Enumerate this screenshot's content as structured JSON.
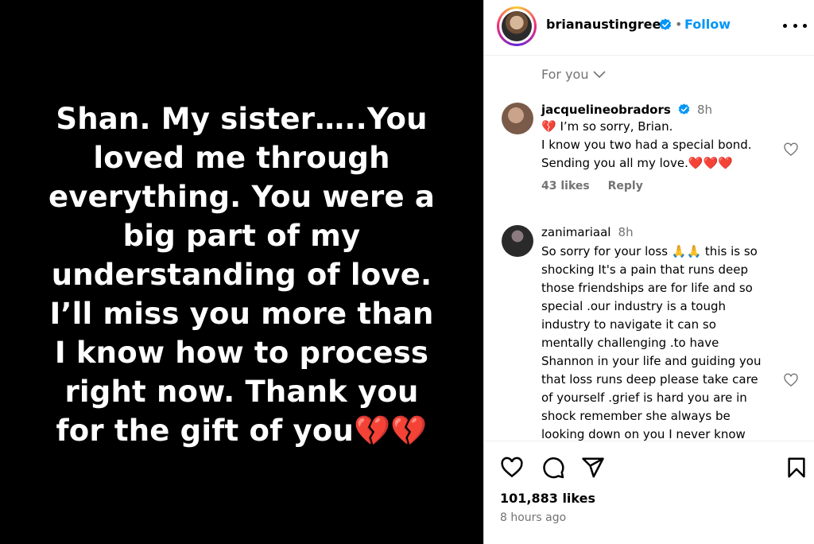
{
  "post": {
    "text_lines": [
      "Shan. My sister…..You",
      "loved me through",
      "everything. You were a",
      "big part of my",
      "understanding of love.",
      "I’ll miss you more than",
      "I know how to process",
      "right now. Thank you",
      "for the gift of you"
    ],
    "hearts": "💔💔"
  },
  "header": {
    "username": "brianaustingreen",
    "separator": "•",
    "follow_label": "Follow"
  },
  "comments_filter": {
    "label": "For you"
  },
  "comments": [
    {
      "username": "jacquelineobradors",
      "verified": true,
      "time": "8h",
      "lines": [
        "💔 I’m so sorry, Brian.",
        "I know you two had a special bond.",
        "Sending you all my love.❤️❤️❤️"
      ],
      "likes": "43 likes",
      "reply": "Reply"
    },
    {
      "username": "zanimariaal",
      "verified": false,
      "time": "8h",
      "lines": [
        "So sorry for your loss 🙏🙏 this is so",
        "shocking It's a pain that runs deep",
        "those friendships are for life and so",
        "special .our industry is a tough",
        "industry to navigate it can so",
        "mentally challenging .to have",
        "Shannon in your life and guiding you",
        "that loss runs deep please take care",
        "of yourself .grief is hard you are in",
        "shock remember she always be",
        "looking down on you I never know"
      ]
    }
  ],
  "footer": {
    "likes": "101,883 likes",
    "time_ago": "8 hours ago"
  },
  "colors": {
    "accent": "#0095f6",
    "verified": "#0095f6",
    "heart": "#e0245e",
    "muted": "#737373"
  }
}
